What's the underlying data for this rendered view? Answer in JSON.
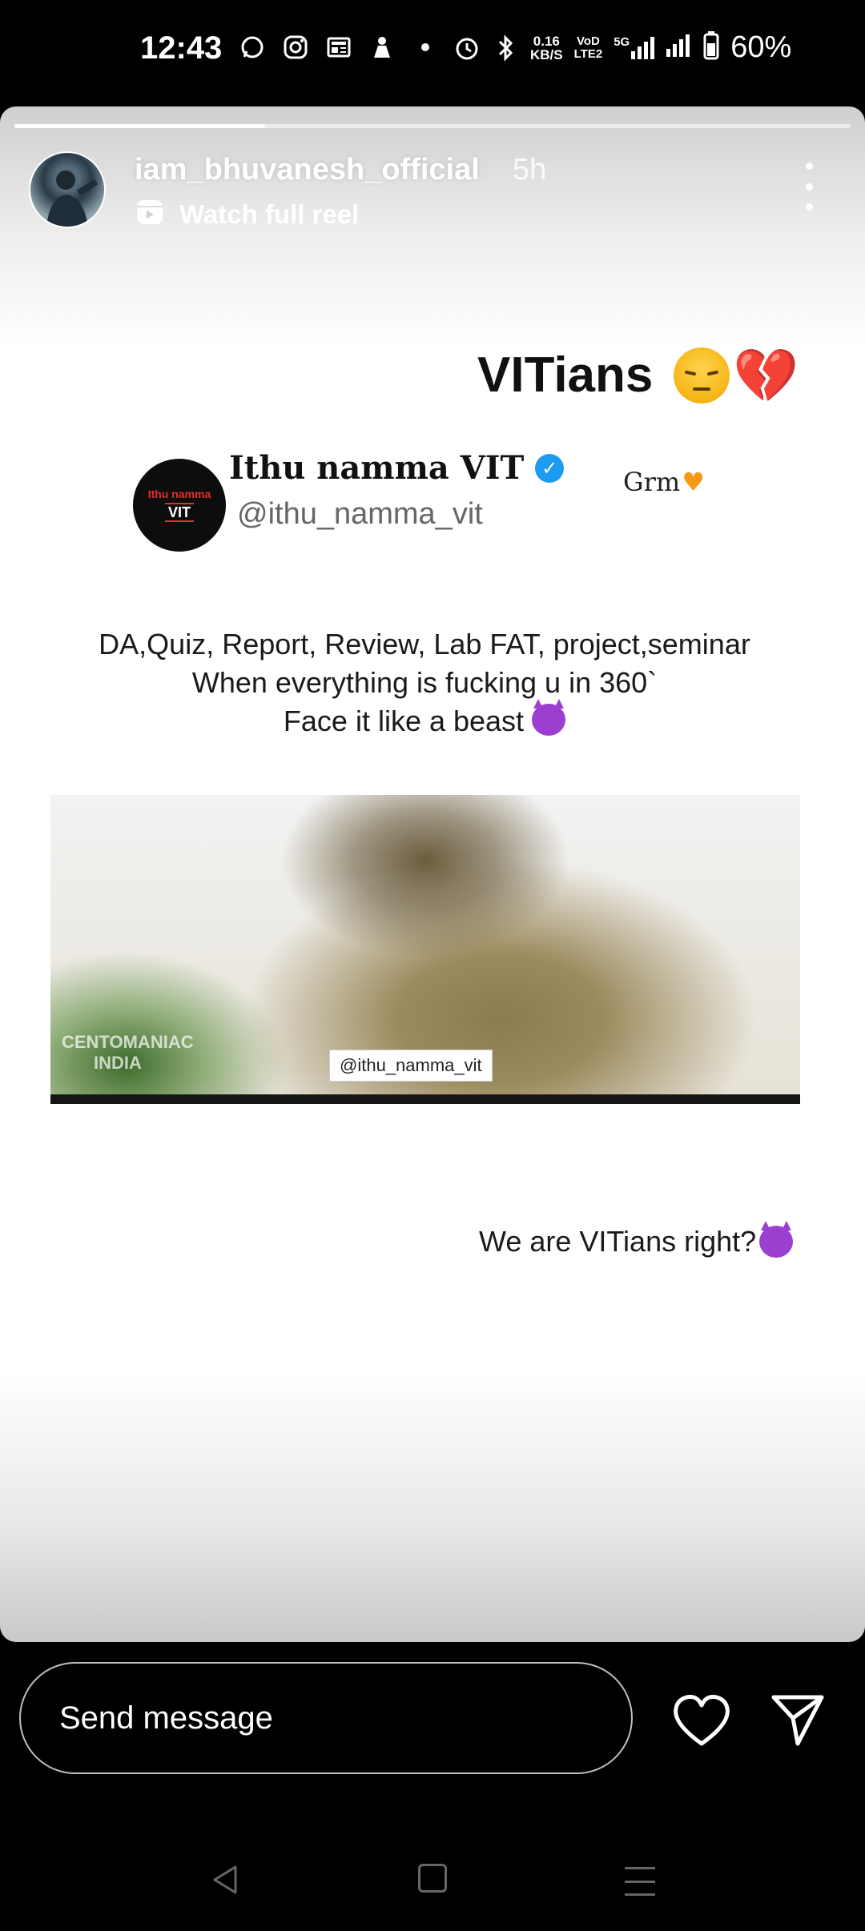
{
  "status_bar": {
    "time": "12:43",
    "net_speed_value": "0.16",
    "net_speed_unit": "KB/S",
    "volte_top": "VoD",
    "volte_bottom": "LTE2",
    "network": "5G",
    "battery": "60%"
  },
  "story": {
    "progress": 0.3,
    "username": "iam_bhuvanesh_official",
    "time_ago": "5h",
    "reel_link": "Watch full reel",
    "title": "VITians",
    "tweet": {
      "avatar_top": "Ithu namma",
      "avatar_bottom": "VIT",
      "name": "Ithu namma VIT",
      "handle": "@ithu_namma_vit",
      "side_note": "Grm"
    },
    "quote_lines": [
      "DA,Quiz, Report, Review, Lab FAT, project,seminar",
      "When everything is fucking u in 360`",
      "Face it like a beast"
    ],
    "video": {
      "watermark_tag": "@ithu_namma_vit",
      "watermark_line1": "CENTOMANIAC",
      "watermark_line2": "INDIA"
    },
    "caption": "We are VITians right?"
  },
  "reply_bar": {
    "placeholder": "Send message"
  },
  "icons": {
    "heart": "heart-icon",
    "send": "send-icon",
    "more": "more-vertical-icon"
  },
  "colors": {
    "verified": "#1d9bf0",
    "devil": "#9b3fd1",
    "broken_heart": "#e0262e"
  }
}
